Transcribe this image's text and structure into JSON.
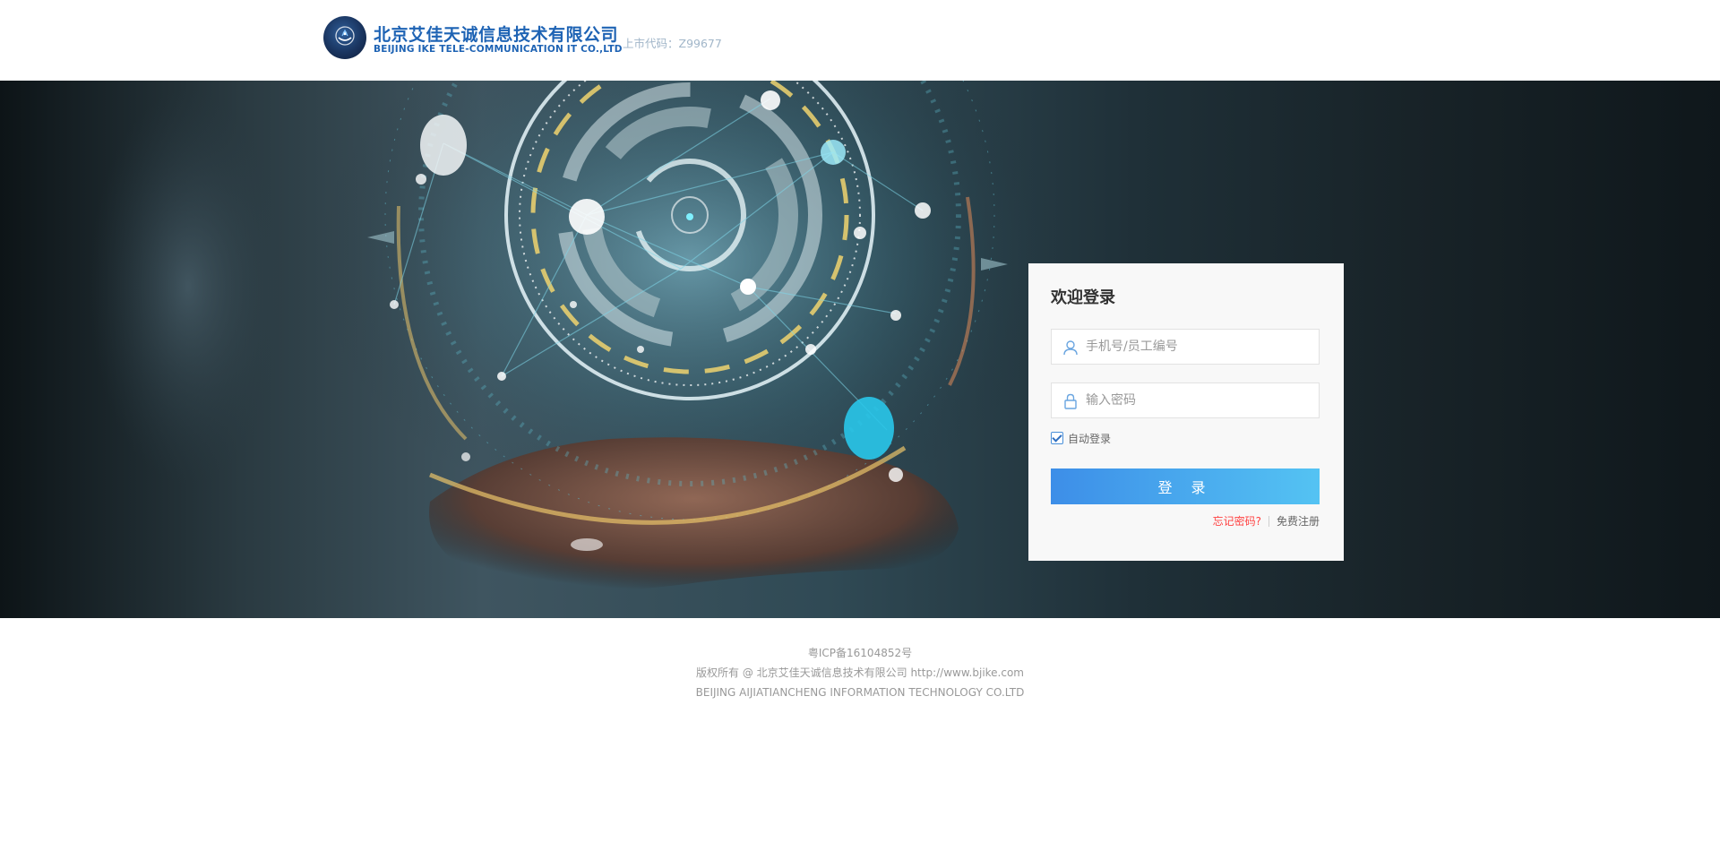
{
  "header": {
    "company_cn": "北京艾佳天诚信息技术有限公司",
    "company_en": "BEIJING IKE TELE-COMMUNICATION IT CO.,LTD",
    "stock_code": "上市代码：Z99677"
  },
  "login": {
    "title": "欢迎登录",
    "username_placeholder": "手机号/员工编号",
    "password_placeholder": "输入密码",
    "remember_label": "自动登录",
    "remember_checked": true,
    "submit_label": "登 录",
    "forgot_label": "忘记密码?",
    "register_label": "免费注册"
  },
  "footer": {
    "icp": "粤ICP备16104852号",
    "copyright": "版权所有 @ 北京艾佳天诚信息技术有限公司 http://www.bjike.com",
    "company_en": "BEIJING AIJIATIANCHENG INFORMATION TECHNOLOGY CO.LTD"
  },
  "colors": {
    "brand_blue": "#1e63b4",
    "stock_code": "#a1b6c9",
    "title": "#333333",
    "placeholder": "#999999",
    "label": "#666666",
    "forgot": "#ff4242",
    "panel_bg": "#f8f8f8",
    "button_start": "#3d8ee8",
    "button_end": "#54c3f3"
  },
  "icons": {
    "logo": "company-logo",
    "user": "user-icon",
    "lock": "lock-icon",
    "check": "checkbox-check-icon"
  }
}
